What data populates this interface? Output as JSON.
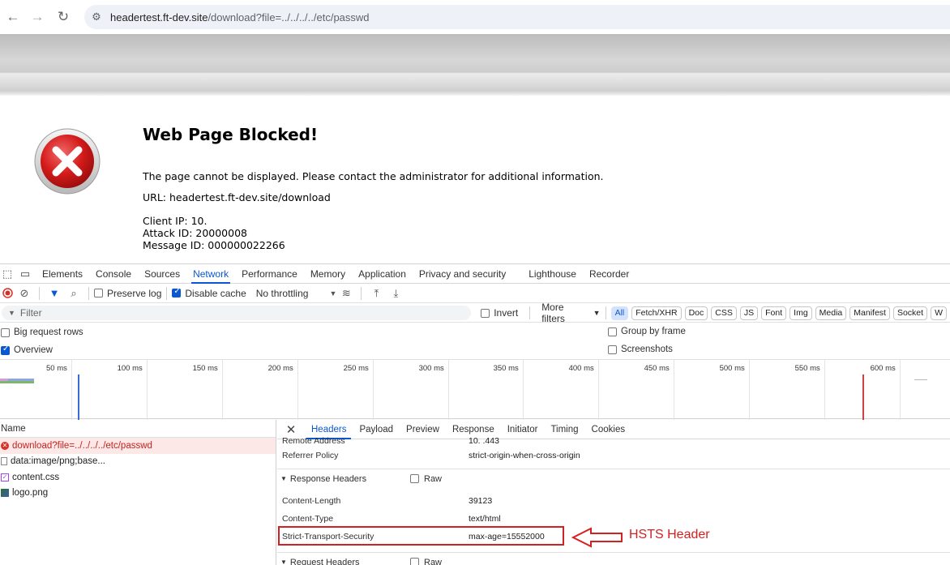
{
  "browser": {
    "url_host": "headertest.ft-dev.site",
    "url_path": "/download?file=../../../../etc/passwd",
    "icons": [
      "back-arrow-icon",
      "forward-arrow-icon",
      "reload-icon",
      "site-info-icon"
    ]
  },
  "blocked_page": {
    "title": "Web Page Blocked!",
    "message": "The page cannot be displayed. Please contact the administrator for additional information.",
    "url_line": "URL: headertest.ft-dev.site/download",
    "client_ip": "Client IP: 10.",
    "attack_id": "Attack ID: 20000008",
    "message_id": "Message ID: 000000022266"
  },
  "devtools": {
    "tabs": [
      "Elements",
      "Console",
      "Sources",
      "Network",
      "Performance",
      "Memory",
      "Application",
      "Privacy and security",
      "Lighthouse",
      "Recorder"
    ],
    "active_tab": "Network",
    "toolbar": {
      "preserve_log": "Preserve log",
      "disable_cache": "Disable cache",
      "throttling": "No throttling"
    },
    "filter": {
      "placeholder": "Filter",
      "invert": "Invert",
      "more_filters": "More filters",
      "types": [
        "All",
        "Fetch/XHR",
        "Doc",
        "CSS",
        "JS",
        "Font",
        "Img",
        "Media",
        "Manifest",
        "Socket",
        "W"
      ]
    },
    "options": {
      "big_rows": "Big request rows",
      "overview": "Overview",
      "group_by_frame": "Group by frame",
      "screenshots": "Screenshots"
    },
    "timeline_ticks": [
      "50 ms",
      "100 ms",
      "150 ms",
      "200 ms",
      "250 ms",
      "300 ms",
      "350 ms",
      "400 ms",
      "450 ms",
      "500 ms",
      "550 ms",
      "600 ms"
    ],
    "name_column": "Name",
    "requests": [
      {
        "name": "download?file=../../../../etc/passwd",
        "status": "error"
      },
      {
        "name": "data:image/png;base...",
        "status": "ok"
      },
      {
        "name": "content.css",
        "status": "ok"
      },
      {
        "name": "logo.png",
        "status": "ok"
      }
    ],
    "detail_tabs": [
      "Headers",
      "Payload",
      "Preview",
      "Response",
      "Initiator",
      "Timing",
      "Cookies"
    ],
    "general": {
      "remote_address_label": "Remote Address",
      "remote_address_value": "10.        .443",
      "referrer_policy_label": "Referrer Policy",
      "referrer_policy_value": "strict-origin-when-cross-origin"
    },
    "response_headers": {
      "title": "Response Headers",
      "raw": "Raw",
      "rows": [
        {
          "name": "Content-Length",
          "value": "39123"
        },
        {
          "name": "Content-Type",
          "value": "text/html"
        },
        {
          "name": "Strict-Transport-Security",
          "value": "max-age=15552000"
        }
      ]
    },
    "request_headers": {
      "title": "Request Headers",
      "raw": "Raw"
    }
  },
  "annotation": {
    "label": "HSTS Header",
    "color": "#d32020"
  }
}
